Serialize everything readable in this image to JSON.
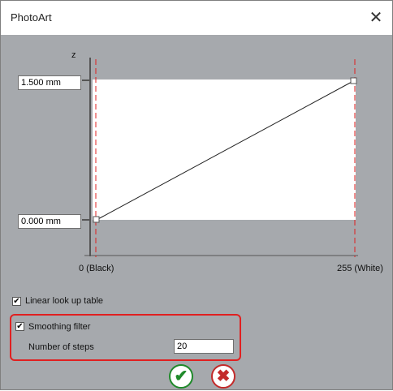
{
  "window": {
    "title": "PhotoArt"
  },
  "graph": {
    "axis_label": "z",
    "top_value": "1.500 mm",
    "bottom_value": "0.000 mm",
    "x_left_label": "0 (Black)",
    "x_right_label": "255 (White)"
  },
  "options": {
    "linear_label": "Linear look up table",
    "linear_checked": true,
    "smoothing_label": "Smoothing filter",
    "smoothing_checked": true,
    "steps_label": "Number of steps",
    "steps_value": "20"
  },
  "buttons": {
    "ok": "✔",
    "cancel": "✖"
  },
  "colors": {
    "guide": "#e02020",
    "ok": "#1f8a2a",
    "cancel": "#c32a2a"
  }
}
